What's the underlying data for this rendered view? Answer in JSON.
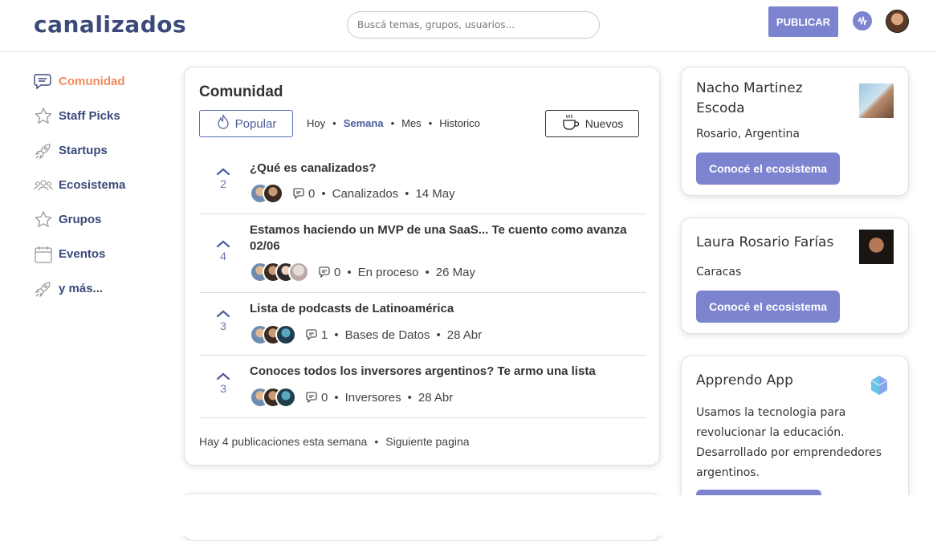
{
  "header": {
    "logo": "canalizados",
    "search_placeholder": "Buscá temas, grupos, usuarios...",
    "publish_label": "PUBLICAR"
  },
  "sidebar": {
    "items": [
      {
        "label": "Comunidad",
        "icon": "chat-icon",
        "active": true
      },
      {
        "label": "Staff Picks",
        "icon": "star-icon"
      },
      {
        "label": "Startups",
        "icon": "rocket-icon"
      },
      {
        "label": "Ecosistema",
        "icon": "people-icon"
      },
      {
        "label": "Grupos",
        "icon": "star-icon"
      },
      {
        "label": "Eventos",
        "icon": "calendar-icon"
      },
      {
        "label": "y más...",
        "icon": "rocket-icon"
      }
    ]
  },
  "feed": {
    "title": "Comunidad",
    "popular_label": "Popular",
    "filters": [
      "Hoy",
      "Semana",
      "Mes",
      "Historico"
    ],
    "selected_filter": "Semana",
    "nuevos_label": "Nuevos",
    "posts": [
      {
        "votes": "2",
        "title": "¿Qué es canalizados?",
        "comments": "0",
        "category": "Canalizados",
        "date": "14 May"
      },
      {
        "votes": "4",
        "title": "Estamos haciendo un MVP de una SaaS... Te cuento como avanza 02/06",
        "comments": "0",
        "category": "En proceso",
        "date": "26 May"
      },
      {
        "votes": "3",
        "title": "Lista de podcasts de Latinoamérica",
        "comments": "1",
        "category": "Bases de Datos",
        "date": "28 Abr"
      },
      {
        "votes": "3",
        "title": "Conoces todos los inversores argentinos? Te armo una lista",
        "comments": "0",
        "category": "Inversores",
        "date": "28 Abr"
      }
    ],
    "footer_count": "Hay 4 publicaciones esta semana",
    "footer_next": "Siguiente pagina"
  },
  "profiles": [
    {
      "name": "Nacho Martinez Escoda",
      "location": "Rosario, Argentina",
      "button": "Conocé el ecosistema"
    },
    {
      "name": "Laura Rosario Farías",
      "location": "Caracas",
      "button": "Conocé el ecosistema"
    },
    {
      "name": "Apprendo App",
      "description": "Usamos la tecnologia para revolucionar la educación. Desarrollado por emprendedores argentinos."
    }
  ],
  "colors": {
    "brand": "#3b4a7a",
    "accent": "#7c83cf",
    "active_nav": "#f08a5d",
    "link": "#4b5d9c"
  }
}
